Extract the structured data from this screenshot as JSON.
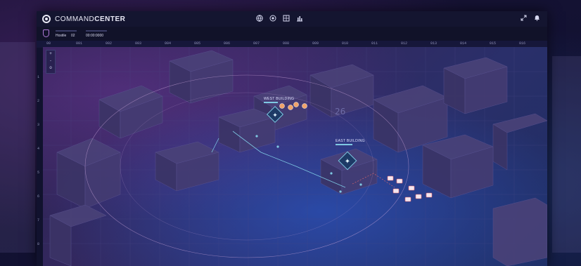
{
  "app": {
    "name_regular": "COMMAND",
    "name_bold": "CENTER"
  },
  "topbar_icons": [
    "globe-icon",
    "layers-icon",
    "grid-icon",
    "chart-icon"
  ],
  "right_icons": [
    "expand-icon",
    "bell-icon"
  ],
  "subbar": {
    "field1_label": "",
    "field1_value": "Hostile",
    "field2_value": "02",
    "field3_value": "00:00:0000"
  },
  "ruler": {
    "columns": [
      "00",
      "001",
      "002",
      "003",
      "004",
      "005",
      "006",
      "007",
      "008",
      "009",
      "010",
      "011",
      "012",
      "013",
      "014",
      "015",
      "016"
    ],
    "rows": [
      "1",
      "2",
      "3",
      "4",
      "5",
      "6",
      "7",
      "8",
      "9"
    ]
  },
  "zoom": {
    "plus": "+",
    "minus": "-",
    "reset": "o"
  },
  "map": {
    "labels": [
      {
        "text": "WEST BUILDING"
      },
      {
        "text": "EAST BUILDING"
      }
    ],
    "grid_number": "26",
    "accent_colors": {
      "marker": "#7ec8e3",
      "hostile": "#e86a6a",
      "circle": "#c9a3d8",
      "map_purple": "#3b2d68"
    }
  }
}
